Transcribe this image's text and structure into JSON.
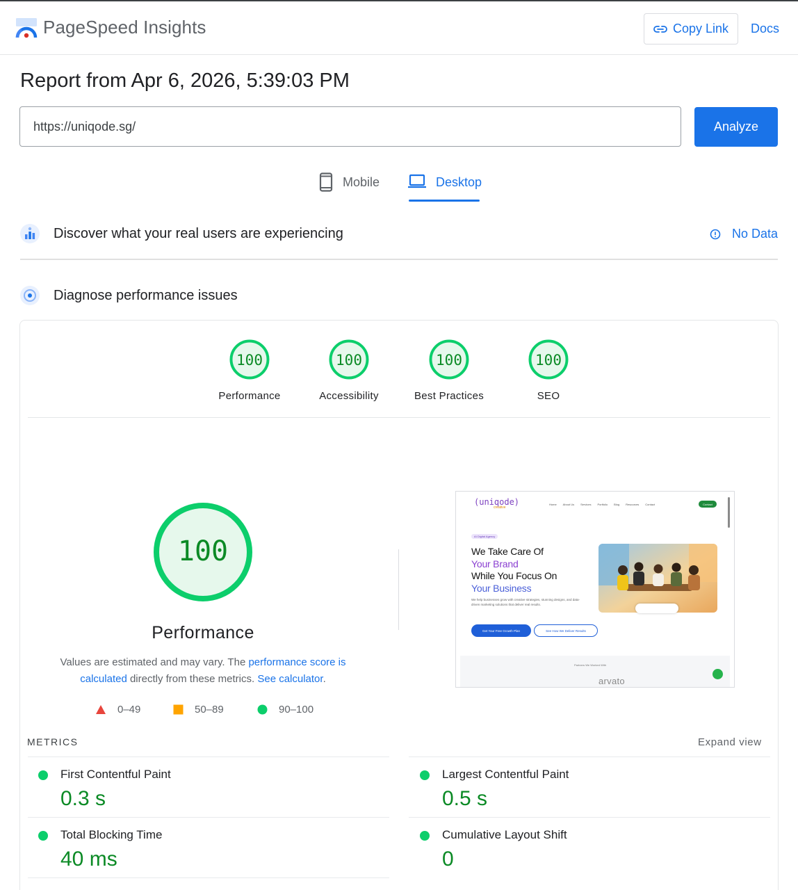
{
  "header": {
    "app_title": "PageSpeed Insights",
    "copy_link_label": "Copy Link",
    "docs_label": "Docs"
  },
  "report": {
    "title": "Report from Apr 6, 2026, 5:39:03 PM"
  },
  "search": {
    "url_value": "https://uniqode.sg/",
    "analyze_label": "Analyze"
  },
  "device_tabs": [
    {
      "label": "Mobile",
      "icon": "phone-icon",
      "selected": false
    },
    {
      "label": "Desktop",
      "icon": "laptop-icon",
      "selected": true
    }
  ],
  "field_data": {
    "title": "Discover what your real users are experiencing",
    "status_label": "No Data",
    "status_icon": "info-icon"
  },
  "diagnose": {
    "title": "Diagnose performance issues"
  },
  "score_summary": [
    {
      "label": "Performance",
      "score": "100"
    },
    {
      "label": "Accessibility",
      "score": "100"
    },
    {
      "label": "Best Practices",
      "score": "100"
    },
    {
      "label": "SEO",
      "score": "100"
    }
  ],
  "performance": {
    "score": "100",
    "label": "Performance",
    "note_prefix": "Values are estimated and may vary. The ",
    "note_link1": "performance score is calculated",
    "note_middle": " directly from these metrics. ",
    "note_link2": "See calculator",
    "note_suffix": "."
  },
  "legend": [
    {
      "range": "0–49",
      "shape": "triangle",
      "color": "#e8453c"
    },
    {
      "range": "50–89",
      "shape": "square",
      "color": "#ffa400"
    },
    {
      "range": "90–100",
      "shape": "circle",
      "color": "#0cce6b"
    }
  ],
  "screenshot_preview": {
    "logo_text": "(uniqode)",
    "logo_sub": "creative",
    "nav_items": [
      "Home",
      "About Us",
      "Services",
      "Portfolio",
      "Blog",
      "Resources",
      "Contact"
    ],
    "nav_button": "Contact",
    "badge": "AI Digital Agency",
    "headline_line1": "We Take Care Of",
    "headline_line2": "Your Brand",
    "headline_line3": "While You Focus On",
    "headline_line4": "Your Business",
    "paragraph": "We help businesses grow with creative strategies, stunning designs, and data-driven marketing solutions that deliver real results.",
    "primary_cta": "Get Your Free Growth Plan",
    "secondary_cta": "See How We Deliver Results",
    "partners_label": "Partners We Worked With",
    "partner_brand": "arvato"
  },
  "metrics": {
    "heading": "METRICS",
    "expand_label": "Expand view",
    "items": [
      {
        "name": "First Contentful Paint",
        "value": "0.3 s",
        "status_color": "#0cce6b"
      },
      {
        "name": "Largest Contentful Paint",
        "value": "0.5 s",
        "status_color": "#0cce6b"
      },
      {
        "name": "Total Blocking Time",
        "value": "40 ms",
        "status_color": "#0cce6b"
      },
      {
        "name": "Cumulative Layout Shift",
        "value": "0",
        "status_color": "#0cce6b"
      }
    ]
  },
  "colors": {
    "accent": "#1a73e8",
    "pass": "#0cce6b",
    "pass_text": "#0b8a25"
  }
}
